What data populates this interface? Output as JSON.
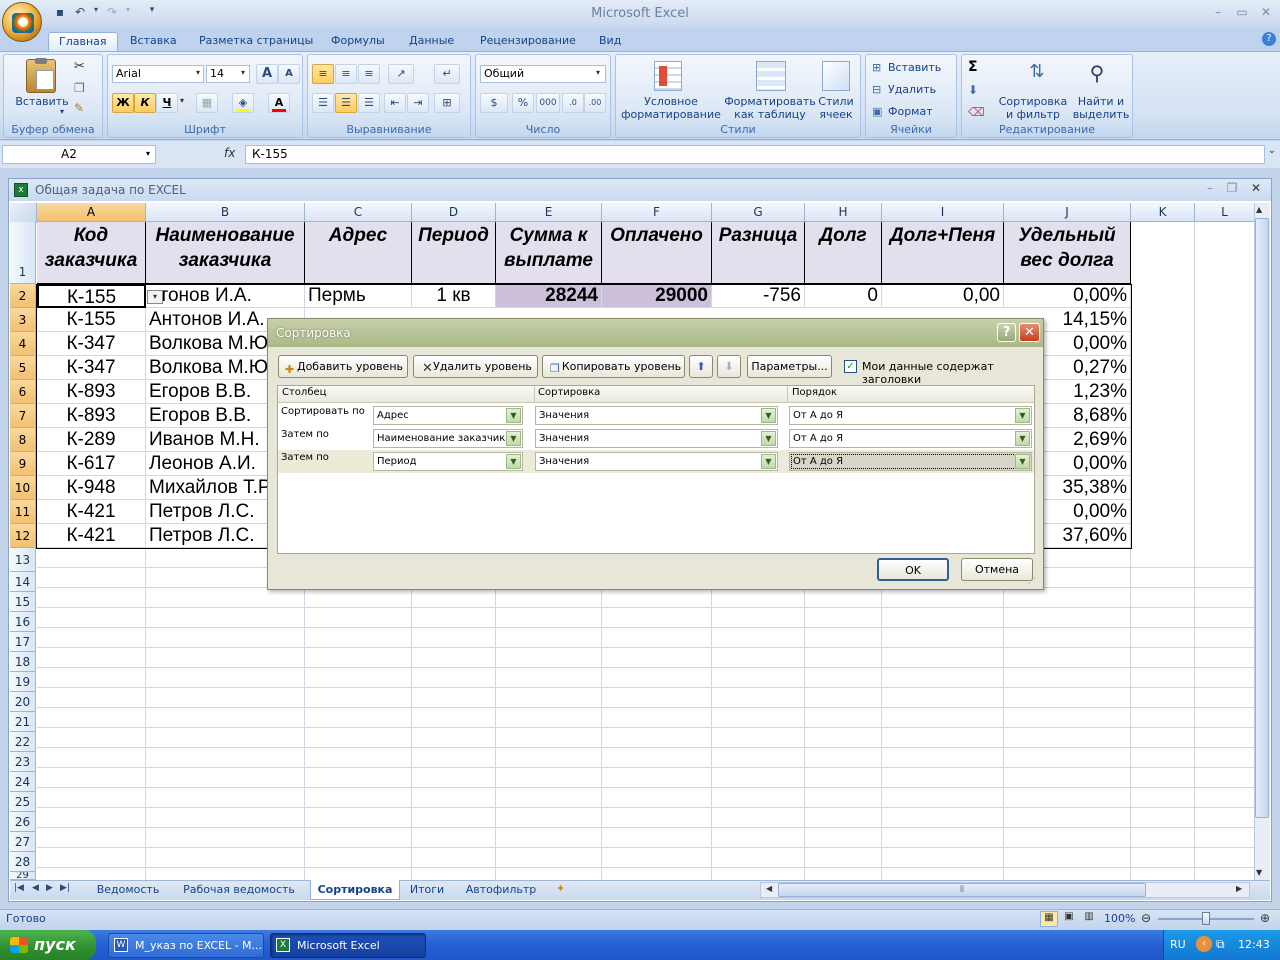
{
  "app": {
    "title": "Microsoft Excel",
    "ribbon_tabs": [
      "Главная",
      "Вставка",
      "Разметка страницы",
      "Формулы",
      "Данные",
      "Рецензирование",
      "Вид"
    ],
    "active_tab": "Главная"
  },
  "ribbon": {
    "clipboard": {
      "label": "Буфер обмена",
      "paste": "Вставить"
    },
    "font": {
      "label": "Шрифт",
      "name": "Arial",
      "size": "14",
      "bold": "Ж",
      "italic": "К",
      "underline": "Ч",
      "grow": "A",
      "shrink": "A"
    },
    "alignment": {
      "label": "Выравнивание"
    },
    "number": {
      "label": "Число",
      "format": "Общий",
      "percent": "%",
      "thousands": "000"
    },
    "styles": {
      "label": "Стили",
      "conditional_1": "Условное",
      "conditional_2": "форматирование",
      "table_1": "Форматировать",
      "table_2": "как таблицу",
      "cell_1": "Стили",
      "cell_2": "ячеек"
    },
    "cells": {
      "label": "Ячейки",
      "insert": "Вставить",
      "delete": "Удалить",
      "format": "Формат"
    },
    "editing": {
      "label": "Редактирование",
      "sort_1": "Сортировка",
      "sort_2": "и фильтр",
      "find_1": "Найти и",
      "find_2": "выделить",
      "sum": "Σ"
    }
  },
  "formula_bar": {
    "name_box": "A2",
    "fx": "fx",
    "value": "К-155"
  },
  "workbook": {
    "title": "Общая задача по EXCEL"
  },
  "sheet": {
    "columns": [
      "A",
      "B",
      "C",
      "D",
      "E",
      "F",
      "G",
      "H",
      "I",
      "J",
      "K",
      "L"
    ],
    "headers": [
      "Код заказчика",
      "Наименование заказчика",
      "Адрес",
      "Период",
      "Сумма к выплате",
      "Оплачено",
      "Разница",
      "Долг",
      "Долг+Пеня",
      "Удельный вес долга"
    ],
    "row_numbers": [
      "1",
      "2",
      "3",
      "4",
      "5",
      "6",
      "7",
      "8",
      "9",
      "10",
      "11",
      "12",
      "13",
      "14",
      "15",
      "16",
      "17",
      "18",
      "19",
      "20",
      "21",
      "22",
      "23",
      "24",
      "25",
      "26",
      "27",
      "28",
      "29"
    ],
    "row2": {
      "a": "К-155",
      "b": "нтонов И.А.",
      "c": "Пермь",
      "d": "1 кв",
      "e": "28244",
      "f": "29000",
      "g": "-756",
      "h": "0",
      "i": "0,00",
      "j": "0,00%"
    },
    "col_a": [
      "К-155",
      "К-347",
      "К-347",
      "К-893",
      "К-893",
      "К-289",
      "К-617",
      "К-948",
      "К-421",
      "К-421"
    ],
    "col_b": [
      "Антонов И.А.",
      "Волкова М.Ю",
      "Волкова М.Ю",
      "Егоров В.В.",
      "Егоров В.В.",
      "Иванов М.Н.",
      "Леонов А.И.",
      "Михайлов Т.Р",
      "Петров Л.С.",
      "Петров Л.С."
    ],
    "col_j": [
      "14,15%",
      "0,00%",
      "0,27%",
      "1,23%",
      "8,68%",
      "2,69%",
      "0,00%",
      "35,38%",
      "0,00%",
      "37,60%"
    ]
  },
  "dialog": {
    "title": "Сортировка",
    "help": "?",
    "add_level": "Добавить уровень",
    "delete_level": "Удалить уровень",
    "copy_level": "Копировать уровень",
    "options": "Параметры...",
    "has_headers": "Мои данные содержат заголовки",
    "col_column": "Столбец",
    "col_sort": "Сортировка",
    "col_order": "Порядок",
    "levels": [
      {
        "label": "Сортировать по",
        "column": "Адрес",
        "sort_on": "Значения",
        "order": "От А до Я"
      },
      {
        "label": "Затем по",
        "column": "Наименование заказчика",
        "sort_on": "Значения",
        "order": "От А до Я"
      },
      {
        "label": "Затем по",
        "column": "Период",
        "sort_on": "Значения",
        "order": "От А до Я"
      }
    ],
    "ok": "OK",
    "cancel": "Отмена"
  },
  "sheet_tabs": [
    "Ведомость",
    "Рабочая ведомость",
    "Сортировка",
    "Итоги",
    "Автофильтр"
  ],
  "active_sheet": "Сортировка",
  "status": {
    "ready": "Готово",
    "zoom": "100%"
  },
  "taskbar": {
    "start": "пуск",
    "tasks": [
      "M_указ по EXCEL - M...",
      "Microsoft Excel"
    ],
    "lang": "RU",
    "clock": "12:43"
  },
  "colors": {
    "header_fill": "#e4dfec",
    "highlight_fill": "#ccc0da",
    "selection": "#f3c06f"
  }
}
